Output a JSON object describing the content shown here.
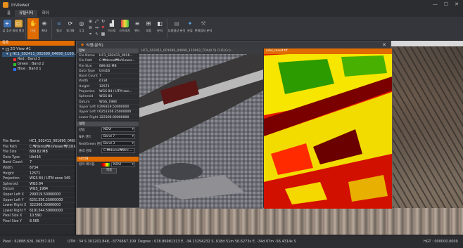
{
  "app": {
    "title": "InViewer"
  },
  "window_controls": [
    "—",
    "☐",
    "✕"
  ],
  "ribbon_tabs": [
    {
      "label": "홈"
    },
    {
      "label": "유틸리티"
    },
    {
      "label": "하이"
    }
  ],
  "ribbon": {
    "buttons": [
      {
        "label": "뷰 추가",
        "icon": "add-view-icon"
      },
      {
        "label": "파일 열기",
        "icon": "folder-open-icon"
      },
      {
        "label": "이동",
        "icon": "pan-icon"
      },
      {
        "label": "확대",
        "icon": "zoom-in-icon"
      },
      {
        "label": "링크",
        "icon": "link-icon"
      },
      {
        "label": "동기화",
        "icon": "sync-icon"
      },
      {
        "label": "1:1",
        "icon": "one-to-one-icon"
      },
      {
        "label": "히스토",
        "icon": "histogram-icon"
      },
      {
        "label": "스트레치",
        "icon": "stretch-icon"
      },
      {
        "label": "밴드",
        "icon": "band-icon"
      },
      {
        "label": "조합",
        "icon": "combine-icon"
      },
      {
        "label": "분석",
        "icon": "analysis-icon"
      },
      {
        "label": "다중영상 분석",
        "icon": "multi-image-icon"
      },
      {
        "label": "분류",
        "icon": "classify-icon"
      },
      {
        "label": "변화탐지 분석",
        "icon": "change-detect-icon"
      }
    ]
  },
  "layers_panel": {
    "header": "목록",
    "view": "2D View #1",
    "file": "HC1_S02411_001690_04690_1100...",
    "bands": [
      {
        "label": "Red : Band 3",
        "color": "#ff3030"
      },
      {
        "label": "Green : Band 2",
        "color": "#30c030"
      },
      {
        "label": "Blue : Band 1",
        "color": "#3070ff"
      }
    ]
  },
  "left_properties": [
    {
      "k": "File Name",
      "v": "HC1_S02411_001690_0469..."
    },
    {
      "k": "File Path",
      "v": "C:₩demo₩InViewer₩다운로..."
    },
    {
      "k": "File Size",
      "v": "689.82 MB"
    },
    {
      "k": "Data Type",
      "v": "UInt16"
    },
    {
      "k": "Band Count",
      "v": "7"
    },
    {
      "k": "Width",
      "v": "6734"
    },
    {
      "k": "Height",
      "v": "12571"
    },
    {
      "k": "Projection",
      "v": "WGS 84 / UTM zone 34S"
    },
    {
      "k": "Spheroid",
      "v": "WGS 84"
    },
    {
      "k": "Datum",
      "v": "WGS_1984"
    },
    {
      "k": "Upper Left X",
      "v": "299319.50000000"
    },
    {
      "k": "Upper Left Y",
      "v": "6251356.25000000"
    },
    {
      "k": "Lower Right X",
      "v": "322306.00000000"
    },
    {
      "k": "Lower Right Y",
      "v": "6191344.50000000"
    },
    {
      "k": "Pixel Size X",
      "v": "10.590"
    },
    {
      "k": "Pixel Size Y",
      "v": "8.565"
    }
  ],
  "dialog": {
    "title": "식생(분석)",
    "info_header": "정보",
    "properties": [
      {
        "k": "File Name",
        "v": "HC1_S02411_0016..."
      },
      {
        "k": "File Path",
        "v": "C:₩demo₩InViewer..."
      },
      {
        "k": "File Size",
        "v": "689.82 MB"
      },
      {
        "k": "Data Type",
        "v": "UInt16"
      },
      {
        "k": "Band Count",
        "v": "7"
      },
      {
        "k": "Width",
        "v": "6734"
      },
      {
        "k": "Height",
        "v": "12571"
      },
      {
        "k": "Projection",
        "v": "WGS 84 / UTM zon..."
      },
      {
        "k": "Spheroid",
        "v": "WGS 84"
      },
      {
        "k": "Datum",
        "v": "WGS_1984"
      },
      {
        "k": "Upper Left X",
        "v": "299319.50000000"
      },
      {
        "k": "Upper Left Y",
        "v": "6251356.25000000"
      },
      {
        "k": "Lower Right X",
        "v": "322306.00000000"
      }
    ],
    "settings_header": "설정",
    "settings": [
      {
        "k": "방법",
        "v": "NDVI"
      },
      {
        "k": "NIR 밴드",
        "v": "Band 7"
      },
      {
        "k": "Red/Green 밴드",
        "v": "Band 3"
      },
      {
        "k": "출력 경로",
        "v": "C:₩demo₩Wrk..."
      }
    ],
    "viz_header": "시각화",
    "legend_label": "컬러 테이블",
    "legend_value": "NDVI",
    "apply": "적용",
    "pane_source_title": "HC1_S02411_001690_04690_110002_TOA(0.5) CH1(Cn)...",
    "pane_result_title": "ndvi_result.tif"
  },
  "status": {
    "pixel": "Pixel : 62888.826, 06357.023",
    "utm": "UTM : 34 S 301201.848, -3776667.109",
    "degree": "Degree : 018.86981313 E, -34.13254232 S,  018d 51m 56.6273s E, -34d 07m -56.4314s S",
    "height": "HGT : 000000.0000"
  },
  "colors": {
    "accent": "#e06b00",
    "bg": "#1e1f22",
    "panel": "#2a2b2f"
  }
}
